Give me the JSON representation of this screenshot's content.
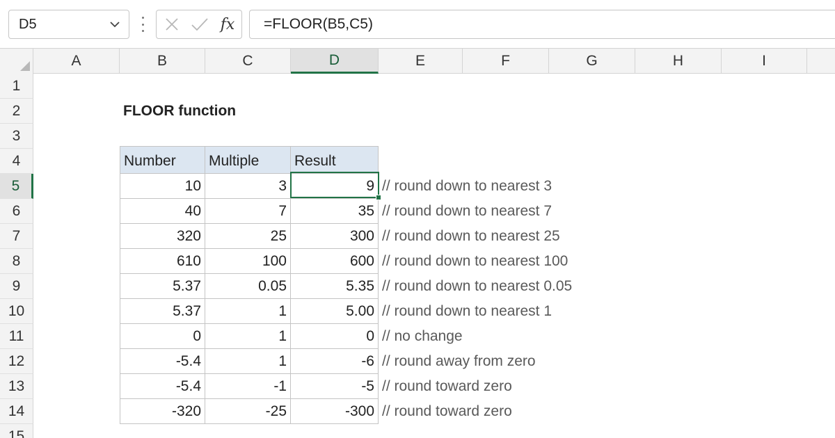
{
  "name_box": {
    "value": "D5"
  },
  "formula": {
    "value": "=FLOOR(B5,C5)"
  },
  "icons": {
    "cancel": "x-icon",
    "enter": "check-icon",
    "fx": "fx-icon"
  },
  "fx_label": "fx",
  "accent_color": "#217346",
  "header_fill": "#dce6f1",
  "columns": [
    "A",
    "B",
    "C",
    "D",
    "E",
    "F",
    "G",
    "H",
    "I"
  ],
  "active_column": "D",
  "rows": [
    "1",
    "2",
    "3",
    "4",
    "5",
    "6",
    "7",
    "8",
    "9",
    "10",
    "11",
    "12",
    "13",
    "14",
    "15"
  ],
  "active_row": "5",
  "sheet": {
    "title": "FLOOR function",
    "headers": [
      "Number",
      "Multiple",
      "Result"
    ],
    "data": [
      {
        "number": "10",
        "multiple": "3",
        "result": "9",
        "comment": "// round down to nearest 3"
      },
      {
        "number": "40",
        "multiple": "7",
        "result": "35",
        "comment": "// round down to nearest 7"
      },
      {
        "number": "320",
        "multiple": "25",
        "result": "300",
        "comment": "// round down to nearest 25"
      },
      {
        "number": "610",
        "multiple": "100",
        "result": "600",
        "comment": "// round down to nearest 100"
      },
      {
        "number": "5.37",
        "multiple": "0.05",
        "result": "5.35",
        "comment": "// round down to nearest 0.05"
      },
      {
        "number": "5.37",
        "multiple": "1",
        "result": "5.00",
        "comment": "// round down to nearest 1"
      },
      {
        "number": "0",
        "multiple": "1",
        "result": "0",
        "comment": "// no change"
      },
      {
        "number": "-5.4",
        "multiple": "1",
        "result": "-6",
        "comment": "// round away from zero"
      },
      {
        "number": "-5.4",
        "multiple": "-1",
        "result": "-5",
        "comment": "// round toward zero"
      },
      {
        "number": "-320",
        "multiple": "-25",
        "result": "-300",
        "comment": "// round toward zero"
      }
    ]
  }
}
